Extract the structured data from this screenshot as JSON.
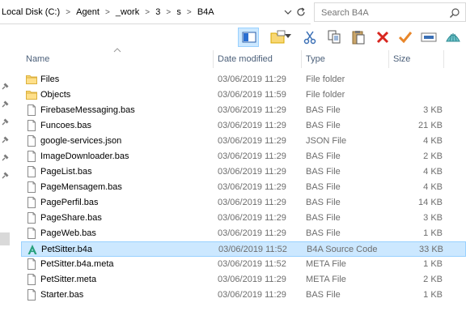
{
  "address": {
    "crumbs": [
      "Local Disk (C:)",
      "Agent",
      "_work",
      "3",
      "s",
      "B4A"
    ],
    "separator": ">"
  },
  "search": {
    "placeholder": "Search B4A"
  },
  "toolbar": {
    "icons": [
      "details-pane-icon",
      "new-folder-icon",
      "cut-icon",
      "copy-icon",
      "paste-icon",
      "delete-icon",
      "select-all-icon",
      "rename-icon",
      "shell-icon"
    ],
    "accent": "#cce8ff"
  },
  "columns": {
    "name": "Name",
    "date": "Date modified",
    "type": "Type",
    "size": "Size"
  },
  "files": [
    {
      "name": "Files",
      "date": "03/06/2019 11:29",
      "type": "File folder",
      "size": "",
      "icon": "folder"
    },
    {
      "name": "Objects",
      "date": "03/06/2019 11:59",
      "type": "File folder",
      "size": "",
      "icon": "folder"
    },
    {
      "name": "FirebaseMessaging.bas",
      "date": "03/06/2019 11:29",
      "type": "BAS File",
      "size": "3 KB",
      "icon": "file"
    },
    {
      "name": "Funcoes.bas",
      "date": "03/06/2019 11:29",
      "type": "BAS File",
      "size": "21 KB",
      "icon": "file"
    },
    {
      "name": "google-services.json",
      "date": "03/06/2019 11:29",
      "type": "JSON File",
      "size": "4 KB",
      "icon": "file"
    },
    {
      "name": "ImageDownloader.bas",
      "date": "03/06/2019 11:29",
      "type": "BAS File",
      "size": "2 KB",
      "icon": "file"
    },
    {
      "name": "PageList.bas",
      "date": "03/06/2019 11:29",
      "type": "BAS File",
      "size": "4 KB",
      "icon": "file"
    },
    {
      "name": "PageMensagem.bas",
      "date": "03/06/2019 11:29",
      "type": "BAS File",
      "size": "4 KB",
      "icon": "file"
    },
    {
      "name": "PagePerfil.bas",
      "date": "03/06/2019 11:29",
      "type": "BAS File",
      "size": "14 KB",
      "icon": "file"
    },
    {
      "name": "PageShare.bas",
      "date": "03/06/2019 11:29",
      "type": "BAS File",
      "size": "3 KB",
      "icon": "file"
    },
    {
      "name": "PageWeb.bas",
      "date": "03/06/2019 11:29",
      "type": "BAS File",
      "size": "1 KB",
      "icon": "file"
    },
    {
      "name": "PetSitter.b4a",
      "date": "03/06/2019 11:52",
      "type": "B4A Source Code",
      "size": "33 KB",
      "icon": "b4a",
      "selected": true
    },
    {
      "name": "PetSitter.b4a.meta",
      "date": "03/06/2019 11:52",
      "type": "META File",
      "size": "1 KB",
      "icon": "file"
    },
    {
      "name": "PetSitter.meta",
      "date": "03/06/2019 11:29",
      "type": "META File",
      "size": "2 KB",
      "icon": "file"
    },
    {
      "name": "Starter.bas",
      "date": "03/06/2019 11:29",
      "type": "BAS File",
      "size": "1 KB",
      "icon": "file"
    }
  ]
}
